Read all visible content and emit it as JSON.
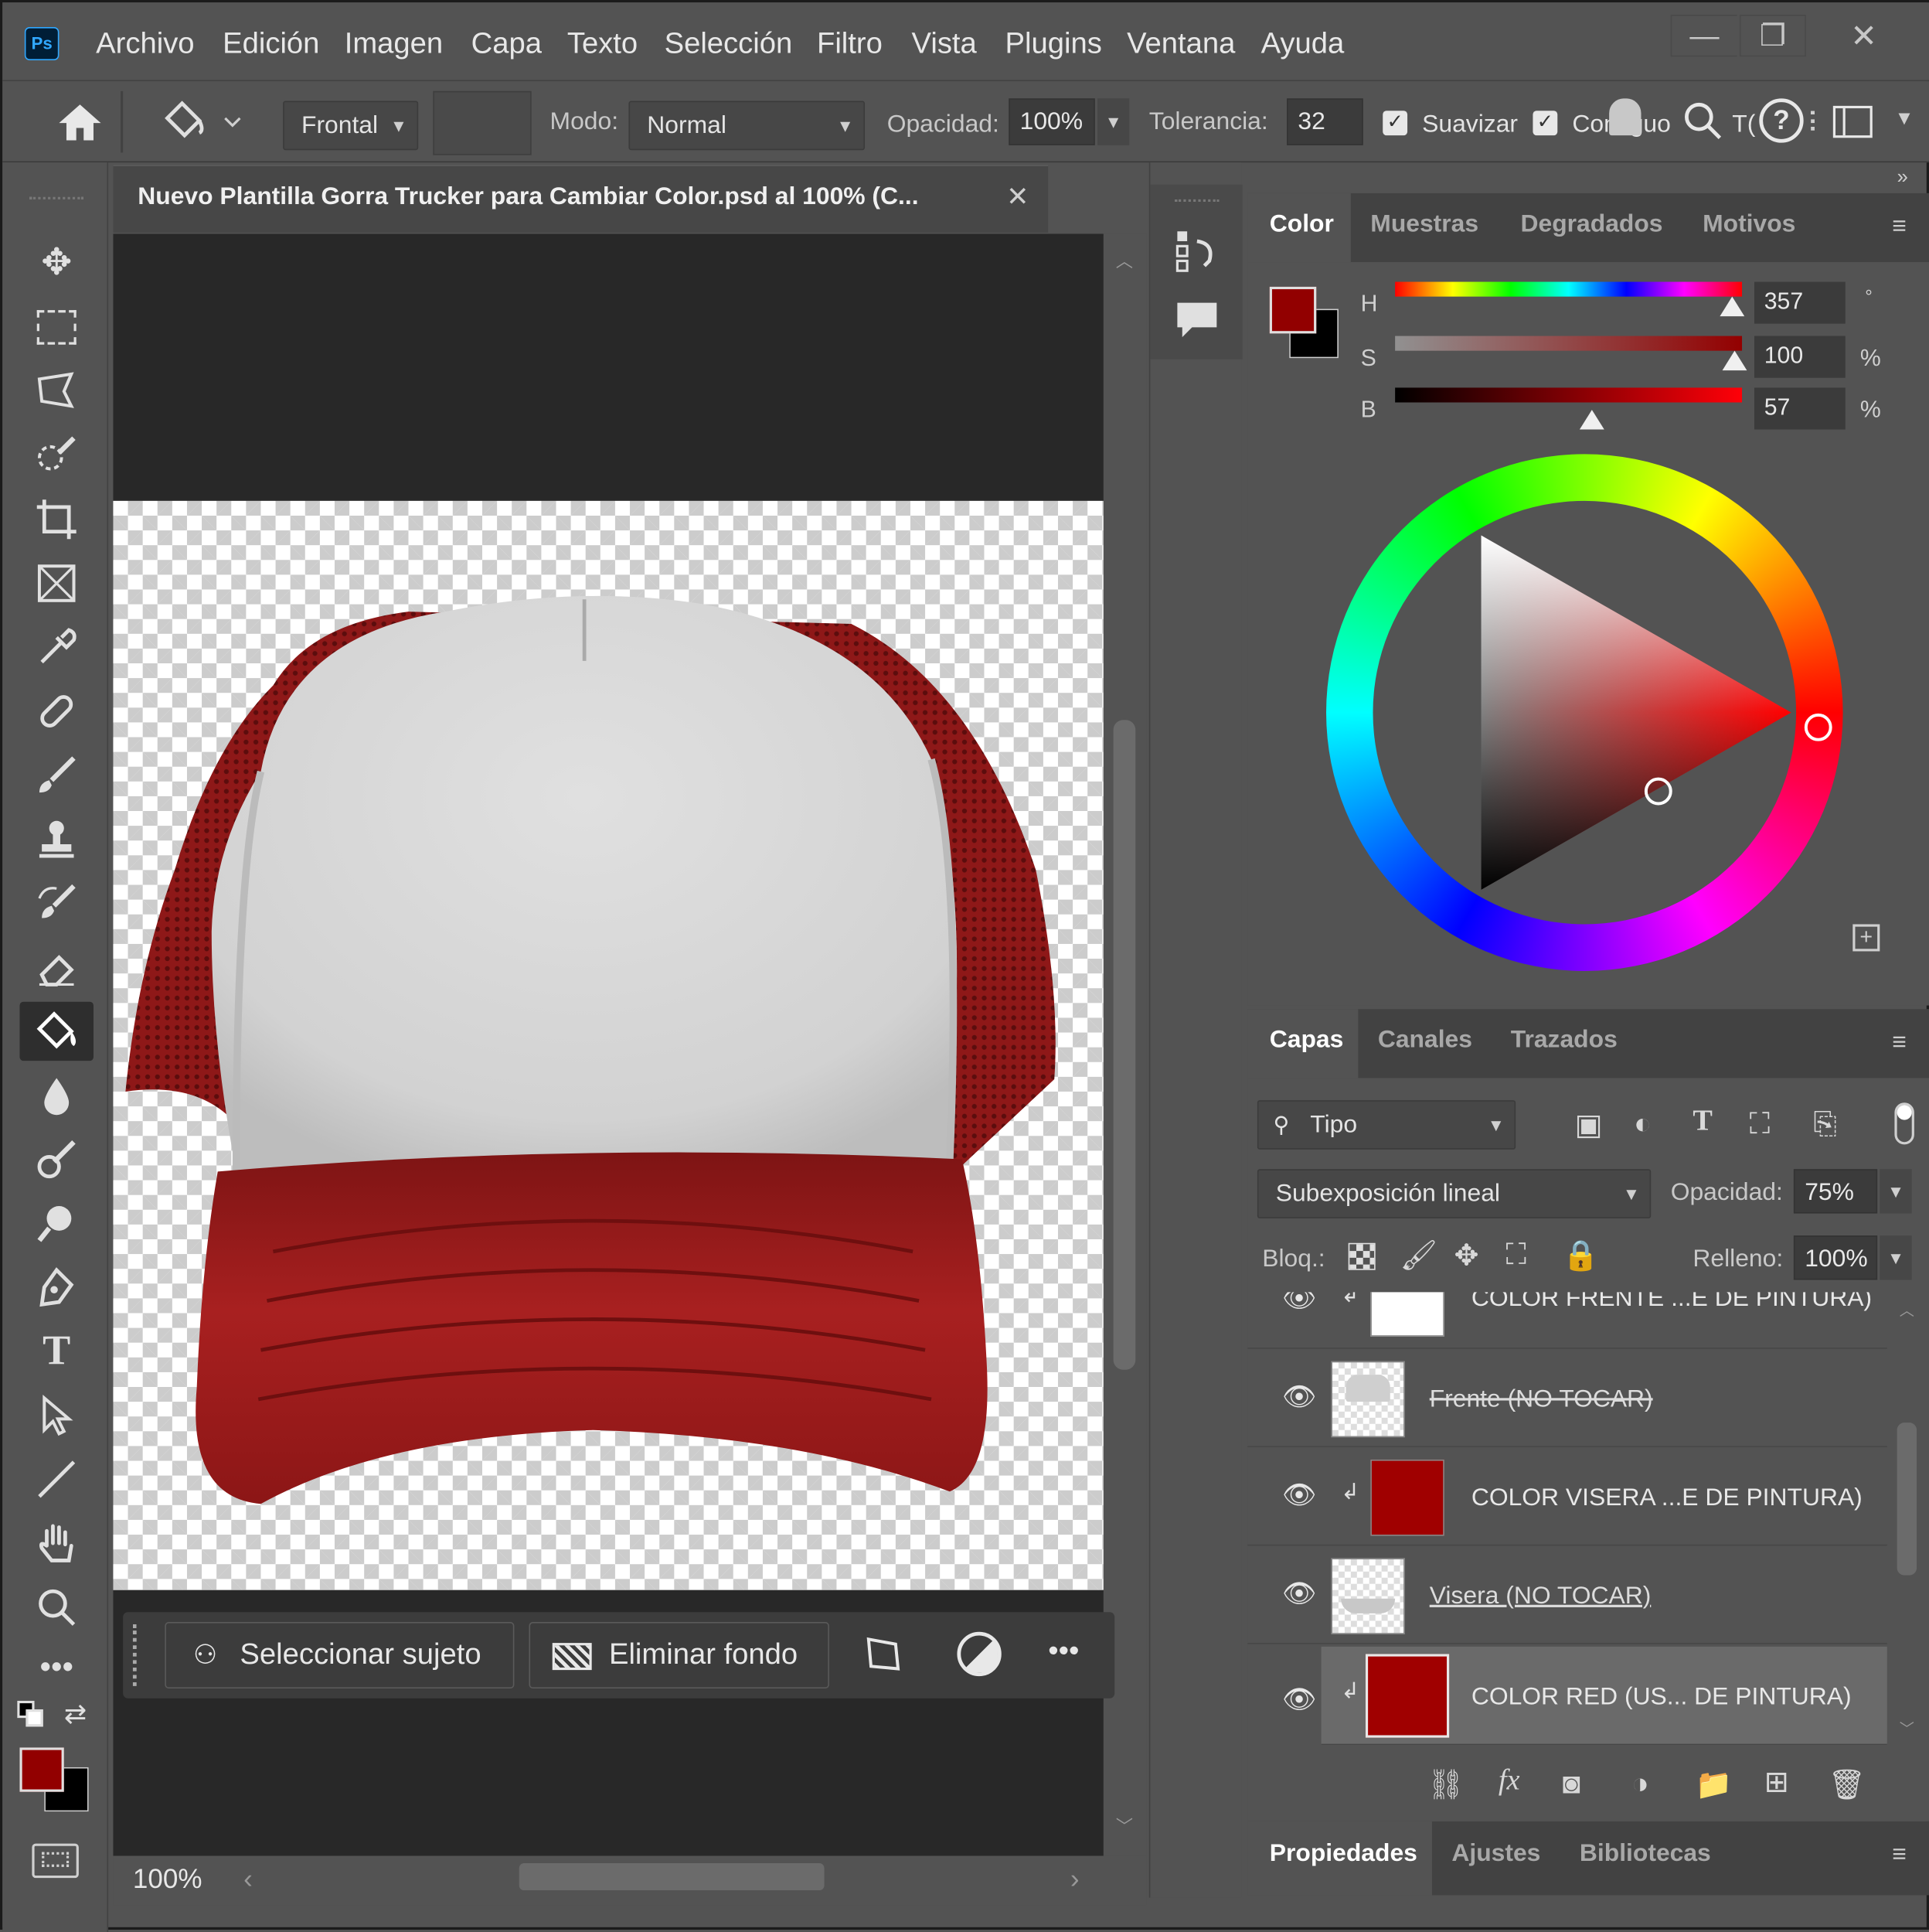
{
  "app": {
    "logo": "Ps",
    "name": "Photoshop"
  },
  "menu": [
    "Archivo",
    "Edición",
    "Imagen",
    "Capa",
    "Texto",
    "Selección",
    "Filtro",
    "Vista",
    "Plugins",
    "Ventana",
    "Ayuda"
  ],
  "window_controls": {
    "minimize": "—",
    "maximize": "❐",
    "close": "✕"
  },
  "options": {
    "source_value": "Frontal",
    "mode_label": "Modo:",
    "mode_value": "Normal",
    "opacity_label": "Opacidad:",
    "opacity_value": "100%",
    "tolerance_label": "Tolerancia:",
    "tolerance_value": "32",
    "smooth_label": "Suavizar",
    "contiguous_label": "Contiguo",
    "all_layers_label": "T(",
    "smooth_checked": true,
    "contiguous_checked": true
  },
  "document": {
    "tab_title": "Nuevo Plantilla Gorra Trucker para Cambiar Color.psd al 100% (C...",
    "zoom": "100%"
  },
  "contextual_taskbar": {
    "select_subject": "Seleccionar sujeto",
    "remove_background": "Eliminar fondo"
  },
  "color_panel": {
    "tabs": [
      "Color",
      "Muestras",
      "Degradados",
      "Motivos"
    ],
    "active_tab": "Color",
    "h_label": "H",
    "h_value": "357",
    "h_unit": "°",
    "s_label": "S",
    "s_value": "100",
    "s_unit": "%",
    "b_label": "B",
    "b_value": "57",
    "b_unit": "%",
    "foreground_color": "#920000",
    "background_color": "#000000"
  },
  "layers_panel": {
    "tabs": [
      "Capas",
      "Canales",
      "Trazados"
    ],
    "active_tab": "Capas",
    "filter_value": "Tipo",
    "blend_mode": "Subexposición lineal",
    "opacity_label": "Opacidad:",
    "opacity_value": "75%",
    "lock_label": "Bloq.:",
    "fill_label": "Relleno:",
    "fill_value": "100%",
    "layers": [
      {
        "name": "COLOR FRENTE ...E DE PINTURA)",
        "clipped": true,
        "thumb": "white"
      },
      {
        "name": "Frente (NO TOCAR)",
        "clipped": false,
        "thumb": "cap-front"
      },
      {
        "name": "COLOR VISERA ...E DE PINTURA)",
        "clipped": true,
        "thumb": "red"
      },
      {
        "name": "Visera (NO TOCAR)",
        "clipped": false,
        "thumb": "cap-visor"
      },
      {
        "name": "COLOR RED (US... DE PINTURA)",
        "clipped": true,
        "thumb": "red",
        "selected": true
      }
    ]
  },
  "bottom_panel": {
    "tabs": [
      "Propiedades",
      "Ajustes",
      "Bibliotecas"
    ],
    "active_tab": "Propiedades"
  },
  "colors": {
    "cap_red": "#9b1a1a",
    "ui_bg": "#535353",
    "canvas_bg": "#282828"
  }
}
